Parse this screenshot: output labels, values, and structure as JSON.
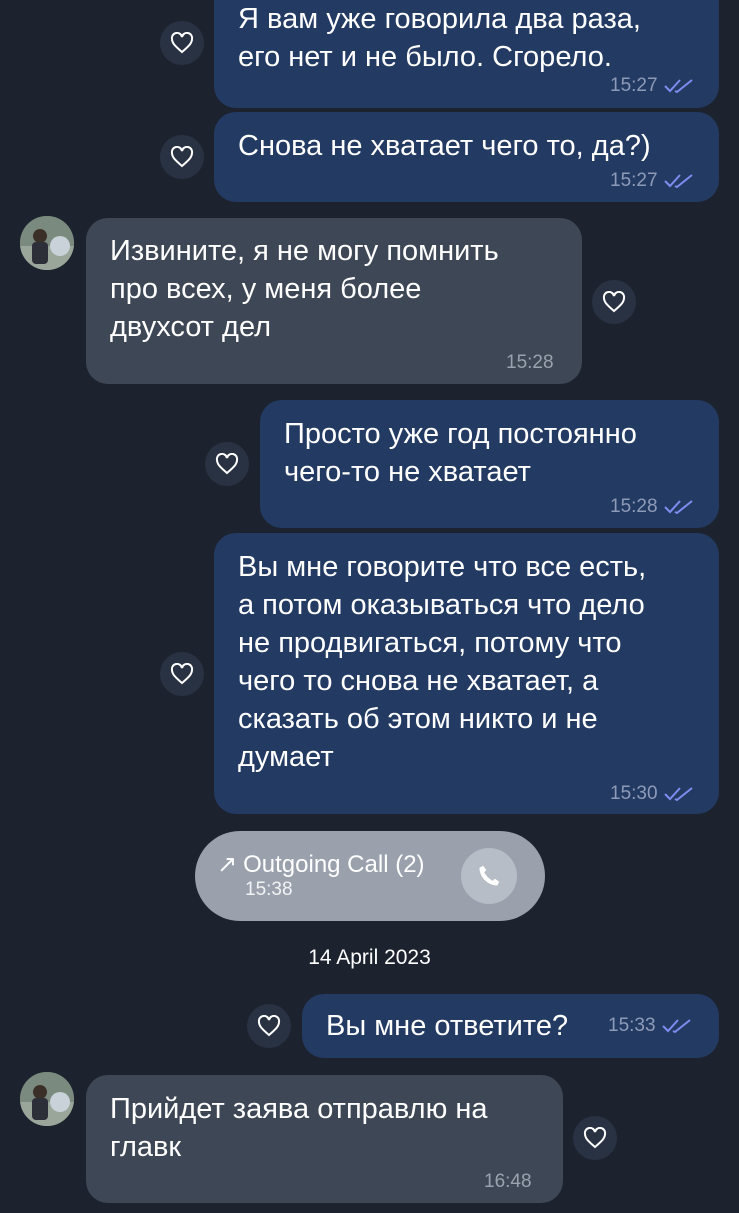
{
  "messages": [
    {
      "text": "Я вам уже говорила два раза,\nего нет и не было. Сгорело.",
      "time": "15:27",
      "from": "me"
    },
    {
      "text": "Снова не хватает чего то, да?)",
      "time": "15:27",
      "from": "me"
    },
    {
      "text": "Извините, я не могу помнить\nпро всех, у меня более\nдвухсот дел",
      "time": "15:28",
      "from": "them"
    },
    {
      "text": "Просто уже год постоянно\nчего-то не хватает",
      "time": "15:28",
      "from": "me"
    },
    {
      "text": "Вы мне говорите что все есть,\nа потом оказываться что дело\nне продвигаться, потому что\nчего то снова не хватает, а\nсказать об этом никто и не\nдумает",
      "time": "15:30",
      "from": "me"
    },
    {
      "text": "Вы мне ответите?",
      "time": "15:33",
      "from": "me"
    },
    {
      "text": "Прийдет заява отправлю на\nглавк",
      "time": "16:48",
      "from": "them"
    }
  ],
  "call": {
    "label": "Outgoing Call (2)",
    "time": "15:38",
    "arrow": "↗"
  },
  "date_separator": "14 April 2023",
  "icons": {
    "reaction": "heart-outline-icon",
    "read": "double-check-icon",
    "call": "phone-icon"
  },
  "colors": {
    "background": "#1c232f",
    "outgoing": "#233a63",
    "incoming": "#3e4755",
    "check": "#7f8cf0"
  }
}
